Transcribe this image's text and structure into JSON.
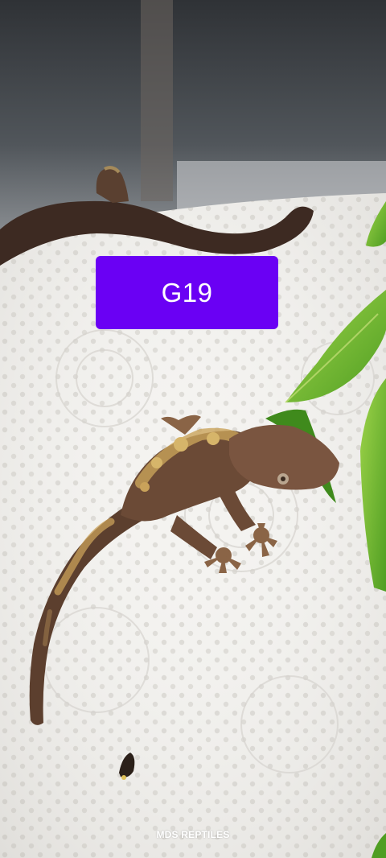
{
  "photo": {
    "subject": "crested-gecko-on-paper-towel",
    "colors": {
      "badge": "#6a00f4",
      "badge_text": "#ffffff",
      "paper_towel": "#f3f2ef",
      "branch": "#3d2a22",
      "gecko_body": "#6b4a36",
      "gecko_pattern": "#c9a25a",
      "leaf": "#6fbf2e",
      "enclosure_glass": "#3a3f44"
    }
  },
  "badge": {
    "label": "G19"
  },
  "watermark": {
    "text": "MDS REPTILES"
  }
}
